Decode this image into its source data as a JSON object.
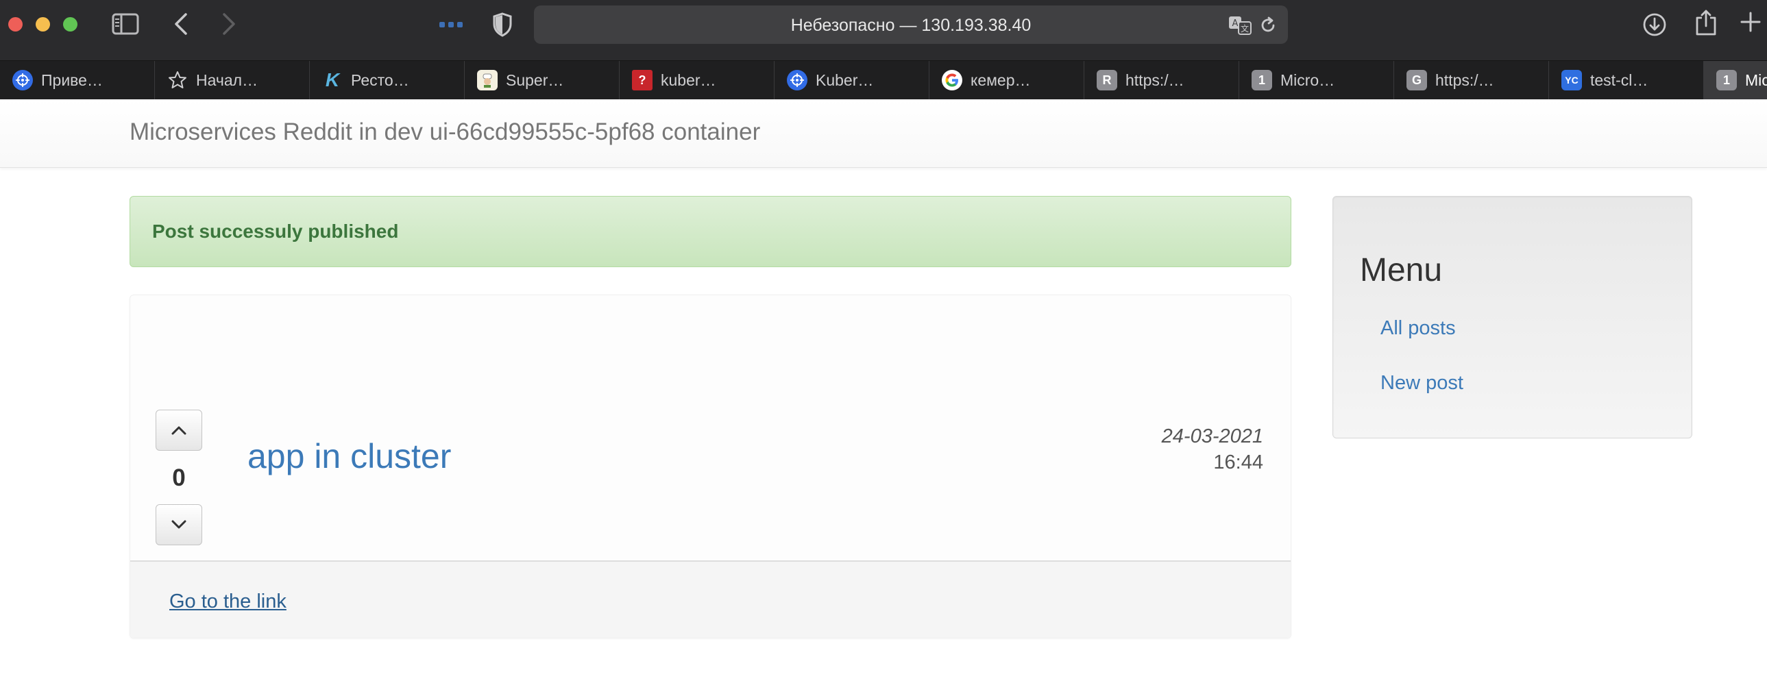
{
  "browser": {
    "address": "Небезопасно — 130.193.38.40",
    "tabs": [
      {
        "label": "Приве…",
        "icon": "kubernetes-icon"
      },
      {
        "label": "Начал…",
        "icon": "star-icon"
      },
      {
        "label": "Ресто…",
        "icon": "k-logo-icon"
      },
      {
        "label": "Super…",
        "icon": "chef-icon"
      },
      {
        "label": "kuber…",
        "icon": "question-mark-icon"
      },
      {
        "label": "Kuber…",
        "icon": "kubernetes-icon"
      },
      {
        "label": "кемер…",
        "icon": "google-icon"
      },
      {
        "label": "https:/…",
        "icon": "r-letter-icon",
        "letter": "R"
      },
      {
        "label": "Micro…",
        "icon": "number-one-icon",
        "letter": "1"
      },
      {
        "label": "https:/…",
        "icon": "g-letter-icon",
        "letter": "G"
      },
      {
        "label": "test-cl…",
        "icon": "yc-icon",
        "letter": "YC"
      },
      {
        "label": "Mic",
        "icon": "number-one-icon",
        "letter": "1"
      }
    ]
  },
  "page": {
    "brand": "Microservices Reddit in dev ui-66cd99555c-5pf68 container",
    "alert": "Post successuly published",
    "post": {
      "votes": "0",
      "title": "app in cluster",
      "date": "24-03-2021",
      "time": "16:44",
      "link_label": "Go to the link"
    },
    "menu": {
      "title": "Menu",
      "items": [
        "All posts",
        "New post"
      ]
    }
  },
  "colors": {
    "link": "#3c7ab8",
    "alert_text": "#3c763d",
    "alert_bg": "#dff0d8"
  }
}
